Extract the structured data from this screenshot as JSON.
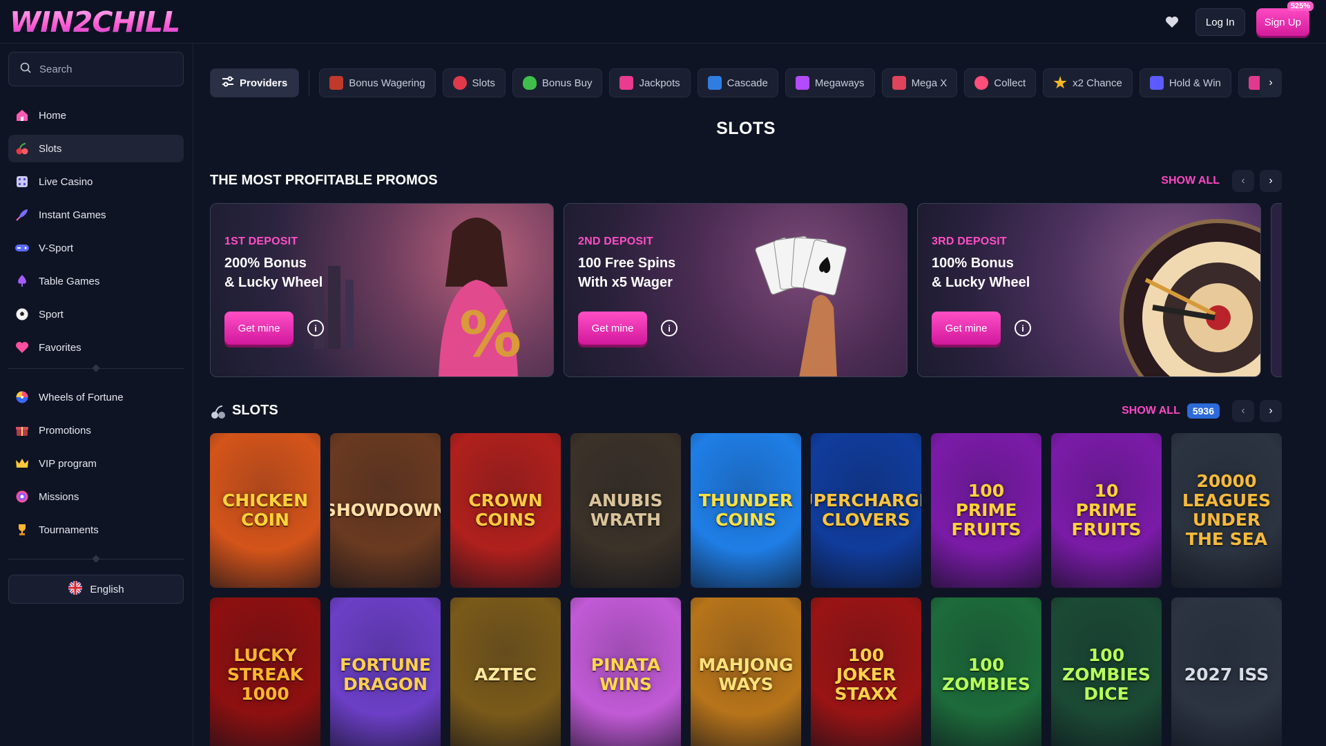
{
  "header": {
    "logo": "WIN2CHILL",
    "login_label": "Log In",
    "signup_label": "Sign Up",
    "signup_badge": "525%"
  },
  "sidebar": {
    "search_placeholder": "Search",
    "items": [
      {
        "label": "Home",
        "icon": "home-icon",
        "active": false
      },
      {
        "label": "Slots",
        "icon": "cherry-icon",
        "active": true
      },
      {
        "label": "Live Casino",
        "icon": "dice-icon",
        "active": false
      },
      {
        "label": "Instant Games",
        "icon": "rocket-icon",
        "active": false
      },
      {
        "label": "V-Sport",
        "icon": "gamepad-icon",
        "active": false
      },
      {
        "label": "Table Games",
        "icon": "spade-icon",
        "active": false
      },
      {
        "label": "Sport",
        "icon": "soccer-ball-icon",
        "active": false
      },
      {
        "label": "Favorites",
        "icon": "heart-icon",
        "active": false
      }
    ],
    "items2": [
      {
        "label": "Wheels of Fortune",
        "icon": "wheel-icon"
      },
      {
        "label": "Promotions",
        "icon": "gift-icon"
      },
      {
        "label": "VIP program",
        "icon": "crown-icon"
      },
      {
        "label": "Missions",
        "icon": "target-icon"
      },
      {
        "label": "Tournaments",
        "icon": "trophy-icon"
      }
    ],
    "language": "English"
  },
  "categories": {
    "providers_label": "Providers",
    "chips": [
      {
        "label": "Bonus Wagering",
        "color": "#c0392b"
      },
      {
        "label": "Slots",
        "color": "#e03a4a"
      },
      {
        "label": "Bonus Buy",
        "color": "#3fbf4a"
      },
      {
        "label": "Jackpots",
        "color": "#e93b8f"
      },
      {
        "label": "Cascade",
        "color": "#2f7de1"
      },
      {
        "label": "Megaways",
        "color": "#b34bff"
      },
      {
        "label": "Mega X",
        "color": "#e0435c"
      },
      {
        "label": "Collect",
        "color": "#ff4f7a"
      },
      {
        "label": "x2 Chance",
        "color": "#f2b824"
      },
      {
        "label": "Hold & Win",
        "color": "#5b5bff"
      }
    ]
  },
  "page_title": "SLOTS",
  "promos_section": {
    "title": "THE MOST PROFITABLE PROMOS",
    "show_all": "SHOW ALL",
    "cards": [
      {
        "kicker": "1ST DEPOSIT",
        "headline": "200% Bonus\n& Lucky Wheel",
        "button": "Get mine"
      },
      {
        "kicker": "2ND DEPOSIT",
        "headline": "100 Free Spins\nWith x5 Wager",
        "button": "Get mine"
      },
      {
        "kicker": "3RD DEPOSIT",
        "headline": "100% Bonus\n& Lucky Wheel",
        "button": "Get mine"
      }
    ]
  },
  "slots_section": {
    "title": "SLOTS",
    "show_all": "SHOW ALL",
    "count": "5936",
    "games": [
      {
        "name": "CHICKEN\nCOIN",
        "bg": "#d4541a",
        "fg": "#ffd23a"
      },
      {
        "name": "SHOWDOWN",
        "bg": "#6a3a20",
        "fg": "#ffe0a8"
      },
      {
        "name": "CROWN\nCOINS",
        "bg": "#b0201c",
        "fg": "#ffcc3e"
      },
      {
        "name": "ANUBIS\nWRATH",
        "bg": "#3b3228",
        "fg": "#d9c39a"
      },
      {
        "name": "THUNDER\nCOINS",
        "bg": "#1f7ee6",
        "fg": "#ffe040"
      },
      {
        "name": "SUPERCHARGED\nCLOVERS",
        "bg": "#103c9c",
        "fg": "#ffc43a"
      },
      {
        "name": "100\nPRIME FRUITS",
        "bg": "#7b1ba8",
        "fg": "#ffd13a"
      },
      {
        "name": "10\nPRIME FRUITS",
        "bg": "#7b1ba8",
        "fg": "#ffd13a"
      },
      {
        "name": "20000\nLEAGUES UNDER THE SEA",
        "bg": "#2b3440",
        "fg": "#f6b93b"
      },
      {
        "name": "LUCKY STREAK\n1000",
        "bg": "#8e1010",
        "fg": "#ffb52e"
      },
      {
        "name": "FORTUNE\nDRAGON",
        "bg": "#6c3fc6",
        "fg": "#ffcf4d"
      },
      {
        "name": "AZTEC",
        "bg": "#7a5a1a",
        "fg": "#ffe69a"
      },
      {
        "name": "PINATA\nWINS",
        "bg": "#c25ad6",
        "fg": "#ffd84a"
      },
      {
        "name": "MAHJONG\nWAYS",
        "bg": "#b7741a",
        "fg": "#ffe17a"
      },
      {
        "name": "100\nJOKER STAXX",
        "bg": "#9a1414",
        "fg": "#ffd14a"
      },
      {
        "name": "100 ZOMBIES",
        "bg": "#1d6b3a",
        "fg": "#b6ff5a"
      },
      {
        "name": "100 ZOMBIES\nDICE",
        "bg": "#1b4a34",
        "fg": "#b6ff5a"
      },
      {
        "name": "2027 ISS",
        "bg": "#2c3442",
        "fg": "#d8dde6"
      }
    ]
  },
  "colors": {
    "accent": "#ff47c4",
    "background": "#0f1424",
    "badge": "#2c6bd8"
  }
}
